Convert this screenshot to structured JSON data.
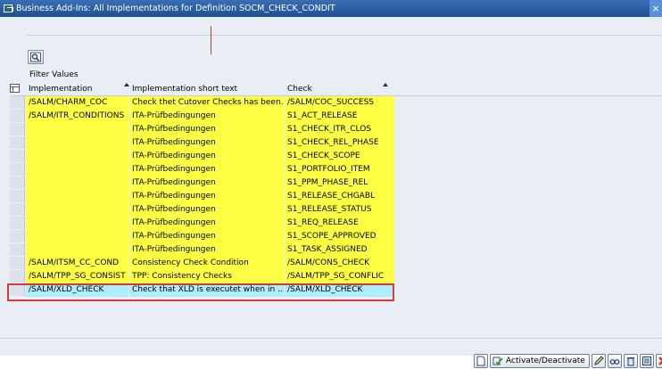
{
  "window": {
    "title": "Business Add-Ins: All Implementations for Definition SOCM_CHECK_CONDIT",
    "close_glyph": "×"
  },
  "toolbar": {
    "filter_icon": "filter-icon"
  },
  "filter": {
    "label": "Filter Values"
  },
  "table": {
    "columns": [
      "Implementation",
      "Implementation short text",
      "Check"
    ],
    "rows": [
      {
        "impl": "/SALM/CHARM_COC",
        "text": "Check thet Cutover Checks has been...",
        "check": "/SALM/COC_SUCCESS",
        "hl": "yellow"
      },
      {
        "impl": "/SALM/ITR_CONDITIONS",
        "text": "ITA-Prüfbedingungen",
        "check": "S1_ACT_RELEASE",
        "hl": "yellow"
      },
      {
        "impl": "",
        "text": "ITA-Prüfbedingungen",
        "check": "S1_CHECK_ITR_CLOS",
        "hl": "yellow"
      },
      {
        "impl": "",
        "text": "ITA-Prüfbedingungen",
        "check": "S1_CHECK_REL_PHASE",
        "hl": "yellow"
      },
      {
        "impl": "",
        "text": "ITA-Prüfbedingungen",
        "check": "S1_CHECK_SCOPE",
        "hl": "yellow"
      },
      {
        "impl": "",
        "text": "ITA-Prüfbedingungen",
        "check": "S1_PORTFOLIO_ITEM",
        "hl": "yellow"
      },
      {
        "impl": "",
        "text": "ITA-Prüfbedingungen",
        "check": "S1_PPM_PHASE_REL",
        "hl": "yellow"
      },
      {
        "impl": "",
        "text": "ITA-Prüfbedingungen",
        "check": "S1_RELEASE_CHGABL",
        "hl": "yellow"
      },
      {
        "impl": "",
        "text": "ITA-Prüfbedingungen",
        "check": "S1_RELEASE_STATUS",
        "hl": "yellow"
      },
      {
        "impl": "",
        "text": "ITA-Prüfbedingungen",
        "check": "S1_REQ_RELEASE",
        "hl": "yellow"
      },
      {
        "impl": "",
        "text": "ITA-Prüfbedingungen",
        "check": "S1_SCOPE_APPROVED",
        "hl": "yellow"
      },
      {
        "impl": "",
        "text": "ITA-Prüfbedingungen",
        "check": "S1_TASK_ASSIGNED",
        "hl": "yellow"
      },
      {
        "impl": "/SALM/ITSM_CC_COND",
        "text": "Consistency Check Condition",
        "check": "/SALM/CONS_CHECK",
        "hl": "yellow"
      },
      {
        "impl": "/SALM/TPP_SG_CONSIST",
        "text": "TPP: Consistency Checks",
        "check": "/SALM/TPP_SG_CONFLIC",
        "hl": "yellow"
      },
      {
        "impl": "/SALM/XLD_CHECK",
        "text": "Check that XLD is executet when in ...",
        "check": "/SALM/XLD_CHECK",
        "hl": "cyan"
      }
    ]
  },
  "buttons": {
    "activate_label": "Activate/Deactivate"
  },
  "colors": {
    "yellow": "#ffff44",
    "cyan": "#aeeefc",
    "highlight": "#d9363e"
  }
}
